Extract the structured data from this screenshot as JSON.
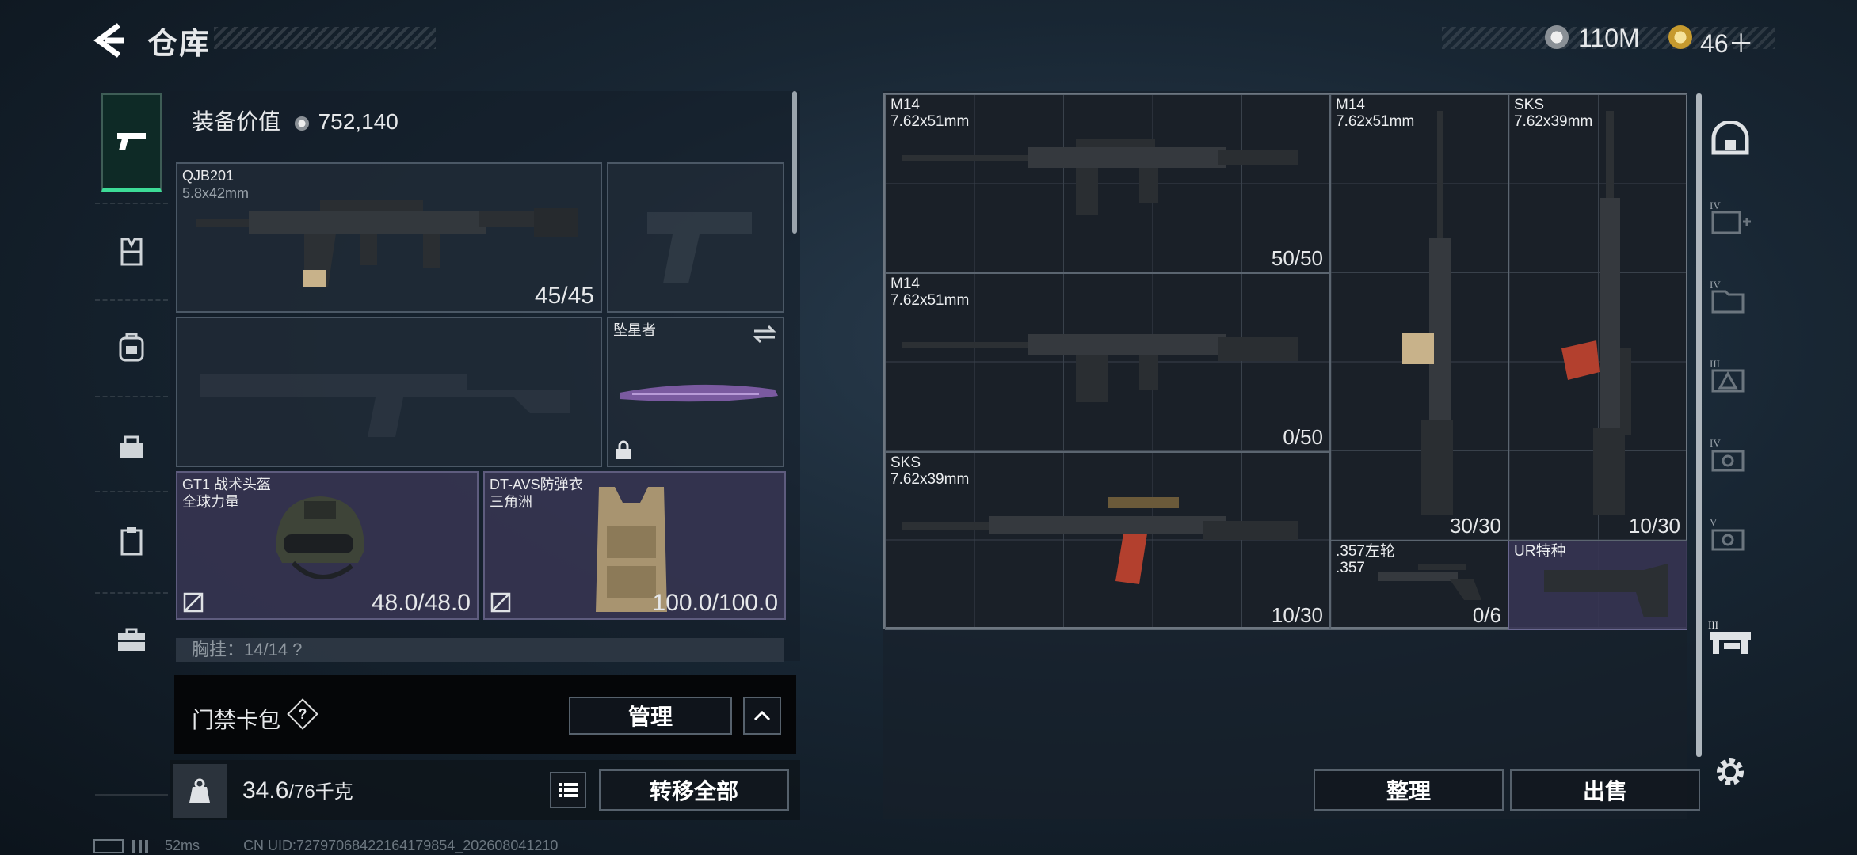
{
  "header": {
    "title": "仓库",
    "currency": [
      {
        "icon": "silver-coin-icon",
        "value": "110M"
      },
      {
        "icon": "gold-coin-icon",
        "value": "46＋"
      }
    ]
  },
  "nav": [
    {
      "name": "pistol-icon",
      "active": true
    },
    {
      "name": "vest-icon",
      "active": false
    },
    {
      "name": "backpack-icon",
      "active": false
    },
    {
      "name": "bag-icon",
      "active": false
    },
    {
      "name": "clipboard-icon",
      "active": false
    },
    {
      "name": "briefcase-icon",
      "active": false
    }
  ],
  "loadout": {
    "equip_value_label": "装备价值",
    "equip_value": "752,140",
    "primary": {
      "name": "QJB201",
      "ammo": "5.8x42mm",
      "count": "45/45"
    },
    "melee": {
      "name": "坠星者"
    },
    "helmet": {
      "name": "GT1 战术头盔",
      "sub": "全球力量",
      "durability": "48.0/48.0"
    },
    "armor": {
      "name": "DT-AVS防弹衣",
      "sub": "三角洲",
      "durability": "100.0/100.0"
    },
    "partial_row": "胸挂：14/14  ?"
  },
  "cardbox": {
    "label": "门禁卡包",
    "help": "?",
    "manage": "管理"
  },
  "bottom": {
    "weight": "34.6",
    "capacity": "/76千克",
    "transfer_all": "转移全部"
  },
  "storage": {
    "items": [
      {
        "name": "M14",
        "ammo": "7.62x51mm",
        "count": "50/50"
      },
      {
        "name": "M14",
        "ammo": "7.62x51mm",
        "count": "0/50"
      },
      {
        "name": "SKS",
        "ammo": "7.62x39mm",
        "count": "10/30"
      },
      {
        "name": "M14",
        "ammo": "7.62x51mm",
        "count": "30/30"
      },
      {
        "name": "SKS",
        "ammo": "7.62x39mm",
        "count": "10/30"
      },
      {
        "name": ".357左轮",
        "ammo": ".357",
        "count": "0/6"
      },
      {
        "name": "UR特种",
        "ammo": "",
        "count": ""
      }
    ],
    "sort": "整理",
    "sell": "出售"
  },
  "right_tabs": [
    "IV",
    "IV",
    "III",
    "IV",
    "V",
    "III"
  ],
  "status": {
    "ping": "52ms",
    "uid": "CN UID:7279706842216417985​4_202608041210"
  },
  "colors": {
    "accent": "#3ddc97",
    "purple_slot": "#383654"
  }
}
